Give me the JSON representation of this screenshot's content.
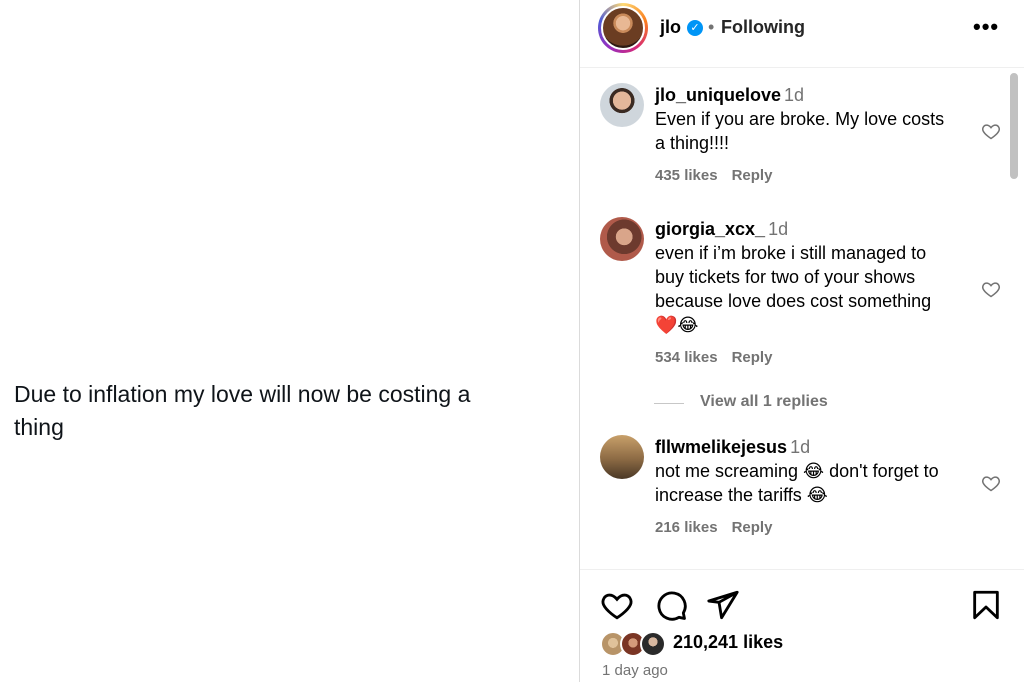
{
  "post": {
    "text": "Due to inflation my love will now be costing a thing"
  },
  "header": {
    "username": "jlo",
    "verified": "✓",
    "separator": "•",
    "following_label": "Following",
    "more_icon": "•••"
  },
  "comments": [
    {
      "username": "jlo_uniquelove",
      "time": "1d",
      "text": "Even if you are broke. My love costs a thing!!!!",
      "likes": "435 likes",
      "reply_label": "Reply"
    },
    {
      "username": "giorgia_xcx_",
      "time": "1d",
      "text": "even if i’m broke i still managed to buy tickets for two of your shows because love does cost something ❤️😂",
      "likes": "534 likes",
      "reply_label": "Reply"
    },
    {
      "username": "fllwmelikejesus",
      "time": "1d",
      "text": "not me screaming 😂 don't forget to increase the tariffs 😂",
      "likes": "216 likes",
      "reply_label": "Reply"
    }
  ],
  "view_replies_label": "View all 1 replies",
  "footer": {
    "likes": "210,241 likes",
    "time": "1 day ago"
  },
  "colors": {
    "verified_blue": "#0095f6",
    "secondary_text": "#737373",
    "border": "#dbdbdb"
  }
}
